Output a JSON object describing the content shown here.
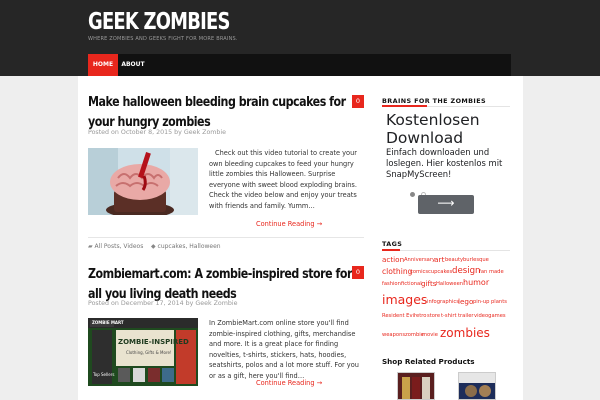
{
  "site": {
    "title": "GEEK ZOMBIES",
    "tagline": "WHERE ZOMBIES AND GEEKS FIGHT FOR MORE BRAINS."
  },
  "nav": {
    "items": [
      {
        "label": "HOME",
        "active": true
      },
      {
        "label": "ABOUT",
        "active": false
      }
    ]
  },
  "colors": {
    "accent": "#e8271d",
    "header_bg": "#262626",
    "nav_bg": "#111111"
  },
  "posts": [
    {
      "title": "Make halloween bleeding brain cupcakes for your hungry zombies",
      "comments": "0",
      "meta": "Posted on October 8, 2015 by Geek Zombie",
      "excerpt": "Check out this video tutorial to create your own bleeding cupcakes to feed your hungry little zombies this Halloween. Surprise everyone with sweet blood exploding brains. Check the video below and enjoy your treats with friends and family. Yumm…",
      "read_more": "Continue Reading →",
      "categories": "All Posts, Videos",
      "tags": "cupcakes, Halloween"
    },
    {
      "title": "Zombiemart.com: A zombie-inspired store for all you living death needs",
      "comments": "0",
      "meta": "Posted on December 17, 2014 by Geek Zombie",
      "excerpt": "In ZombieMart.com online store you'll find zombie-inspired clothing, gifts, merchandise and more. It is a great place for finding novelties, t-shirts, stickers, hats, hoodies, seatshirts, polos and a lot more stuff. For you or as a gift, here you'll find…",
      "read_more": "Continue Reading →",
      "thumb_text": {
        "brand": "ZOMBIE MART",
        "headline": "ZOMBIE-INSPIRED",
        "sub": "Clothing, Gifts & More!",
        "side": "Top Sellers"
      }
    }
  ],
  "sidebar": {
    "brains_title": "BRAINS FOR THE ZOMBIES",
    "ad": {
      "headline": "Kostenlosen Download",
      "body": "Einfach downloaden und loslegen. Hier kostenlos mit SnapMyScreen!",
      "arrow_icon": "arrow-right-icon"
    },
    "tags_title": "TAGS",
    "tags": [
      {
        "label": "action",
        "size": 7.2
      },
      {
        "label": "Anniversary",
        "size": 5.2
      },
      {
        "label": "art",
        "size": 7.4
      },
      {
        "label": "beauty",
        "size": 5.2
      },
      {
        "label": "burlesque",
        "size": 5.2
      },
      {
        "label": "clothing",
        "size": 7.6
      },
      {
        "label": "comics",
        "size": 5.2
      },
      {
        "label": "cupcakes",
        "size": 5.2
      },
      {
        "label": "design",
        "size": 8.6
      },
      {
        "label": "fan made",
        "size": 5.2
      },
      {
        "label": "fashion",
        "size": 5.2
      },
      {
        "label": "fictional",
        "size": 5.2
      },
      {
        "label": "gifts",
        "size": 7.2
      },
      {
        "label": "Halloween",
        "size": 5.2
      },
      {
        "label": "humor",
        "size": 8.0
      },
      {
        "label": "images",
        "size": 12.5
      },
      {
        "label": "infographics",
        "size": 5.2
      },
      {
        "label": "lego",
        "size": 7.2
      },
      {
        "label": "pin-up",
        "size": 5.2
      },
      {
        "label": "plants",
        "size": 5.2
      },
      {
        "label": "Resident Evil",
        "size": 5.2
      },
      {
        "label": "retro",
        "size": 5.2
      },
      {
        "label": "store",
        "size": 5.2
      },
      {
        "label": "t-shirt",
        "size": 5.2
      },
      {
        "label": "trailer",
        "size": 5.2
      },
      {
        "label": "videogames",
        "size": 5.2
      },
      {
        "label": "weapons",
        "size": 5.2
      },
      {
        "label": "zombie",
        "size": 5.2
      },
      {
        "label": "movie",
        "size": 5.2
      },
      {
        "label": "zombies",
        "size": 12.0
      }
    ],
    "shop_title": "Shop Related Products"
  }
}
